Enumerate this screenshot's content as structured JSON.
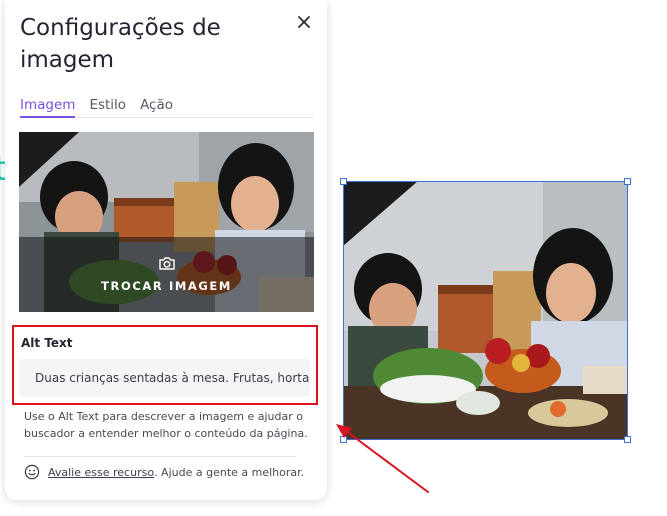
{
  "panel": {
    "title": "Configurações de imagem",
    "close_icon": "close-icon",
    "tabs": [
      {
        "label": "Imagem",
        "active": true
      },
      {
        "label": "Estilo",
        "active": false
      },
      {
        "label": "Ação",
        "active": false
      }
    ],
    "preview": {
      "camera_icon": "camera-icon",
      "swap_label": "TROCAR IMAGEM"
    },
    "alt": {
      "label": "Alt Text",
      "value": "Duas crianças sentadas à mesa. Frutas, horta"
    },
    "help_text": "Use o Alt Text para descrever a imagem e ajudar o buscador a entender melhor o conteúdo da página.",
    "feedback": {
      "icon": "smile-icon",
      "link": "Avalie esse recurso",
      "rest": ". Ajude a gente a melhorar."
    }
  },
  "colors": {
    "accent": "#7b4fe0",
    "highlight_box": "#d9141e",
    "selection": "#3f6fd8",
    "annotation_arrow": "#d9141e"
  }
}
